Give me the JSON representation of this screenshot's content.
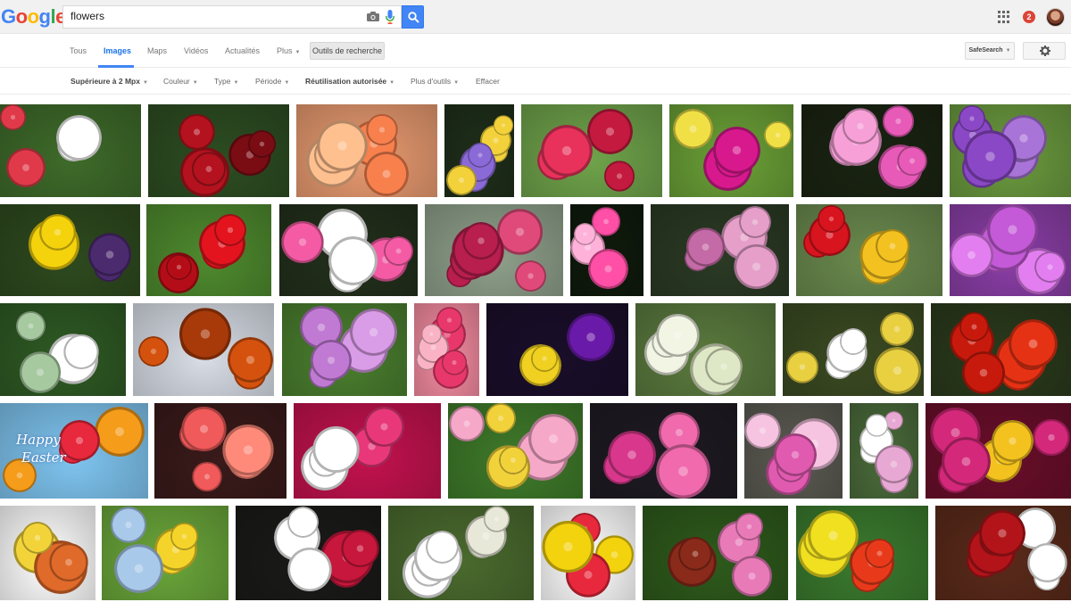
{
  "logo": {
    "letters": [
      "G",
      "o",
      "o",
      "g",
      "l",
      "e"
    ],
    "colors": [
      "#4285f4",
      "#ea4335",
      "#fbbc05",
      "#4285f4",
      "#34a853",
      "#ea4335"
    ]
  },
  "search": {
    "query": "flowers"
  },
  "header": {
    "notification_count": "2"
  },
  "tabs": [
    {
      "label": "Tous",
      "active": false
    },
    {
      "label": "Images",
      "active": true
    },
    {
      "label": "Maps",
      "active": false
    },
    {
      "label": "Vidéos",
      "active": false
    },
    {
      "label": "Actualités",
      "active": false
    },
    {
      "label": "Plus",
      "active": false
    }
  ],
  "tools_label": "Outils de recherche",
  "safesearch_label": "SafeSearch",
  "filters": [
    {
      "label": "Supérieure à 2 Mpx",
      "bold": true,
      "dropdown": true
    },
    {
      "label": "Couleur",
      "bold": false,
      "dropdown": true
    },
    {
      "label": "Type",
      "bold": false,
      "dropdown": true
    },
    {
      "label": "Période",
      "bold": false,
      "dropdown": true
    },
    {
      "label": "Réutilisation autorisée",
      "bold": true,
      "dropdown": true
    },
    {
      "label": "Plus d'outils",
      "bold": false,
      "dropdown": true
    },
    {
      "label": "Effacer",
      "bold": false,
      "dropdown": false
    }
  ],
  "results": [
    {
      "row": 1,
      "bg": "#3e6b2a",
      "accent": "#e03a4a",
      "accent2": "#ffffff"
    },
    {
      "row": 1,
      "bg": "#2d4d22",
      "accent": "#b3121e",
      "accent2": "#7a0c14"
    },
    {
      "row": 1,
      "bg": "#e89a70",
      "accent": "#f7804d",
      "accent2": "#ffc08f"
    },
    {
      "row": 1,
      "bg": "#1f2e1a",
      "accent": "#f2d13b",
      "accent2": "#8a6ad6"
    },
    {
      "row": 1,
      "bg": "#6fa34a",
      "accent": "#e8325b",
      "accent2": "#c41a3f"
    },
    {
      "row": 1,
      "bg": "#6aa037",
      "accent": "#d8198e",
      "accent2": "#f0e046"
    },
    {
      "row": 1,
      "bg": "#1a2412",
      "accent": "#e85ab8",
      "accent2": "#f7a0d8"
    },
    {
      "row": 1,
      "bg": "#6b9a3e",
      "accent": "#8a48c6",
      "accent2": "#a974d8"
    },
    {
      "row": 2,
      "bg": "#2e4a1f",
      "accent": "#f5d30c",
      "accent2": "#4b2a6e"
    },
    {
      "row": 2,
      "bg": "#4e8a2e",
      "accent": "#e3141e",
      "accent2": "#b50d17"
    },
    {
      "row": 2,
      "bg": "#23301c",
      "accent": "#f45ba4",
      "accent2": "#ffffff"
    },
    {
      "row": 2,
      "bg": "#8ea08a",
      "accent": "#b81e4e",
      "accent2": "#e04a7a"
    },
    {
      "row": 2,
      "bg": "#0f1a0c",
      "accent": "#ff4fa6",
      "accent2": "#ffb2d9"
    },
    {
      "row": 2,
      "bg": "#2a3a24",
      "accent": "#e59fc9",
      "accent2": "#c46aa6"
    },
    {
      "row": 2,
      "bg": "#6b8a4e",
      "accent": "#d8141e",
      "accent2": "#f4c220"
    },
    {
      "row": 2,
      "bg": "#8a3ea6",
      "accent": "#c45ad8",
      "accent2": "#e27ef0"
    },
    {
      "row": 3,
      "bg": "#2f5a24",
      "accent": "#ffffff",
      "accent2": "#a7c9a0"
    },
    {
      "row": 3,
      "bg": "#d8dde6",
      "accent": "#d5520e",
      "accent2": "#a83a0a"
    },
    {
      "row": 3,
      "bg": "#4a7f2f",
      "accent": "#c07ad3",
      "accent2": "#d99ce6"
    },
    {
      "row": 3,
      "bg": "#f28aa0",
      "accent": "#e8386b",
      "accent2": "#f9b3c4"
    },
    {
      "row": 3,
      "bg": "#1a0e2a",
      "accent": "#6a1aa8",
      "accent2": "#f0d020"
    },
    {
      "row": 3,
      "bg": "#5b7a3e",
      "accent": "#f2f4e4",
      "accent2": "#dfe8c6"
    },
    {
      "row": 3,
      "bg": "#3b4a22",
      "accent": "#ffffff",
      "accent2": "#e8d040"
    },
    {
      "row": 3,
      "bg": "#2a3a1c",
      "accent": "#e63214",
      "accent2": "#c81a0c"
    },
    {
      "row": 4,
      "bg": "#7ec4ef",
      "accent": "#f59c1a",
      "accent2": "#e8283c",
      "overlay": [
        "Happy",
        "Easter"
      ]
    },
    {
      "row": 4,
      "bg": "#3a1a1a",
      "accent": "#f05a5a",
      "accent2": "#ff8a7a"
    },
    {
      "row": 4,
      "bg": "#c2124e",
      "accent": "#e8387a",
      "accent2": "#ffffff"
    },
    {
      "row": 4,
      "bg": "#3f7a2a",
      "accent": "#f6a8c8",
      "accent2": "#f2d23a"
    },
    {
      "row": 4,
      "bg": "#1e1a22",
      "accent": "#d8378c",
      "accent2": "#f06aad"
    },
    {
      "row": 4,
      "bg": "#5a5a52",
      "accent": "#e05ab0",
      "accent2": "#f6c4e0"
    },
    {
      "row": 4,
      "bg": "#4a6b3a",
      "accent": "#e8a8d4",
      "accent2": "#ffffff"
    },
    {
      "row": 4,
      "bg": "#6a0e2a",
      "accent": "#d4287a",
      "accent2": "#f3c21e"
    },
    {
      "row": 5,
      "bg": "#ffffff",
      "accent": "#f2d43a",
      "accent2": "#e06a2a"
    },
    {
      "row": 5,
      "bg": "#6aa63a",
      "accent": "#f4d42a",
      "accent2": "#a8c9ea"
    },
    {
      "row": 5,
      "bg": "#1a1a18",
      "accent": "#c8173c",
      "accent2": "#ffffff"
    },
    {
      "row": 5,
      "bg": "#4a6a2e",
      "accent": "#ffffff",
      "accent2": "#e8e8d8"
    },
    {
      "row": 5,
      "bg": "#ffffff",
      "accent": "#e8283c",
      "accent2": "#f3d20e"
    },
    {
      "row": 5,
      "bg": "#2e5a1c",
      "accent": "#e87ab8",
      "accent2": "#8a2a1a"
    },
    {
      "row": 5,
      "bg": "#3a7a2e",
      "accent": "#f0e020",
      "accent2": "#e83a1a"
    },
    {
      "row": 5,
      "bg": "#5a2a1a",
      "accent": "#b2141a",
      "accent2": "#ffffff"
    }
  ]
}
